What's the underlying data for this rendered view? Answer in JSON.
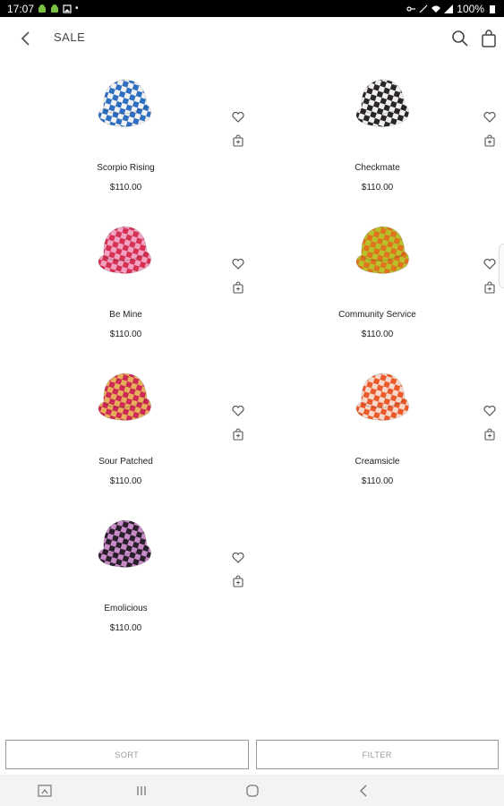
{
  "status_bar": {
    "time": "17:07",
    "battery": "100%"
  },
  "app_bar": {
    "title": "SALE"
  },
  "products": [
    {
      "name": "Scorpio Rising",
      "price": "$110.00",
      "colors": [
        "#2f6fc1",
        "#f2f2f2"
      ]
    },
    {
      "name": "Checkmate",
      "price": "$110.00",
      "colors": [
        "#2a2626",
        "#f0efef"
      ]
    },
    {
      "name": "Be Mine",
      "price": "$110.00",
      "colors": [
        "#d63256",
        "#f0a4c2"
      ]
    },
    {
      "name": "Community Service",
      "price": "$110.00",
      "colors": [
        "#e0741e",
        "#b8c02a"
      ]
    },
    {
      "name": "Sour Patched",
      "price": "$110.00",
      "colors": [
        "#cf2a55",
        "#e6b05b"
      ]
    },
    {
      "name": "Creamsicle",
      "price": "$110.00",
      "colors": [
        "#ec5a2b",
        "#f6d9cb"
      ]
    },
    {
      "name": "Emolicious",
      "price": "$110.00",
      "colors": [
        "#2a1f2c",
        "#c98bc8"
      ]
    }
  ],
  "bottom": {
    "sort_label": "SORT",
    "filter_label": "FILTER"
  }
}
